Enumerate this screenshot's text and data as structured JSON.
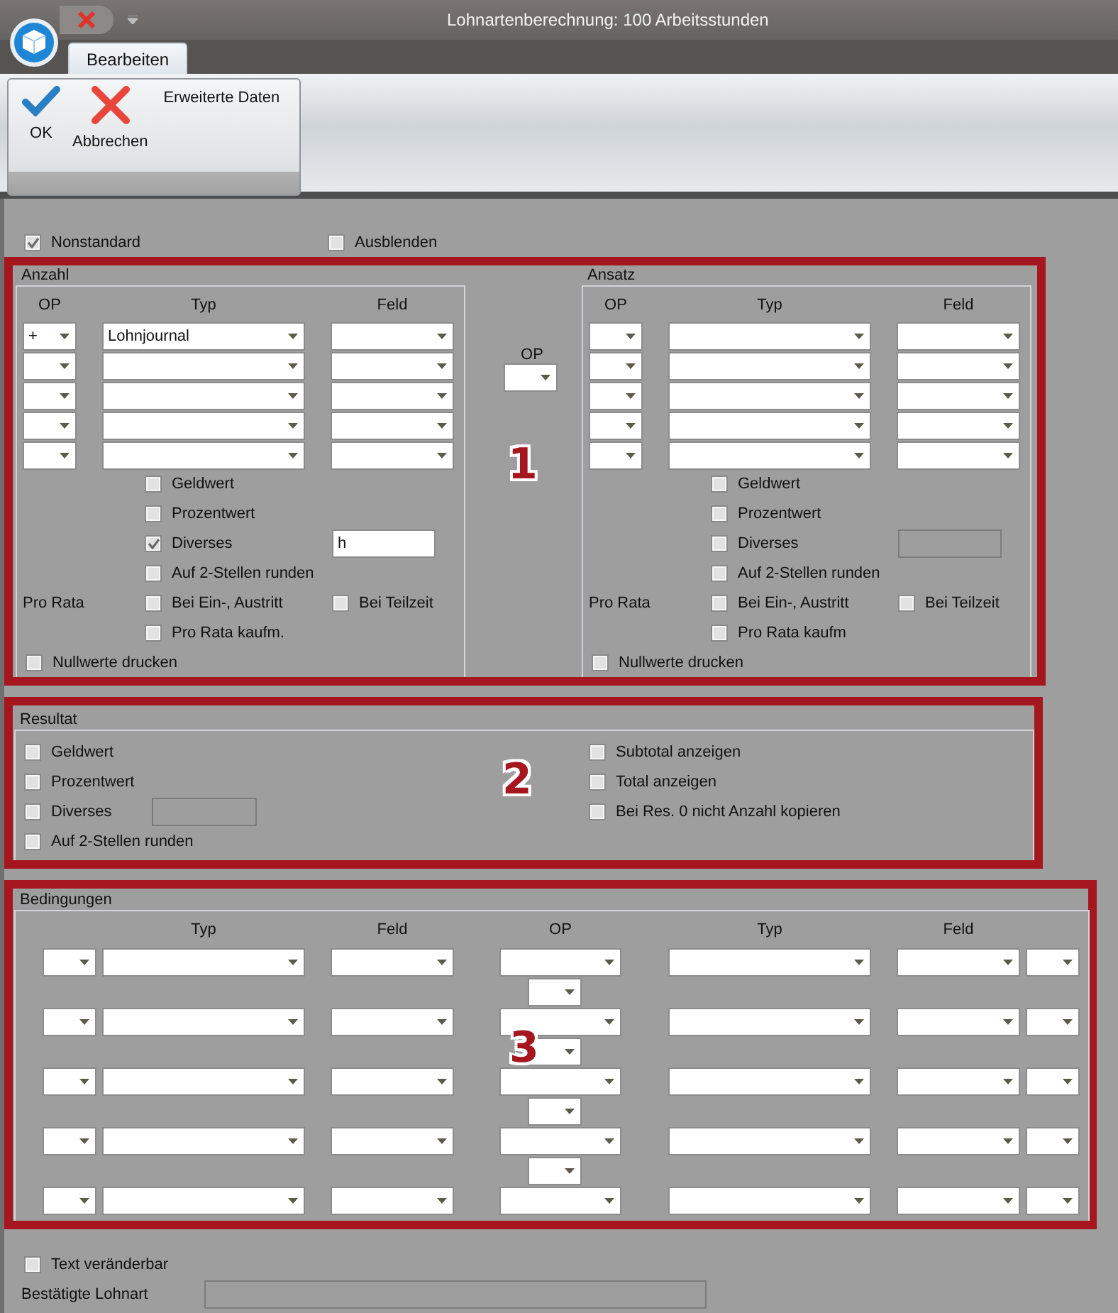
{
  "window": {
    "title": "Lohnartenberechnung: 100 Arbeitsstunden"
  },
  "tabs": [
    {
      "label": "Bearbeiten",
      "selected": true
    }
  ],
  "ribbon": {
    "buttons": [
      {
        "label": "OK",
        "kind": "ok"
      },
      {
        "label": "Abbrechen",
        "kind": "cancel"
      }
    ],
    "label": "Erweiterte Daten"
  },
  "top_options": [
    {
      "label": "Nonstandard",
      "checked": true
    },
    {
      "label": "Ausblenden",
      "checked": false
    }
  ],
  "section_1": {
    "marker": "1",
    "middle_op_label": "OP",
    "panels": [
      {
        "title": "Anzahl",
        "headers": [
          "OP",
          "Typ",
          "Feld"
        ],
        "rows": [
          {
            "op": "+",
            "typ": "Lohnjournal"
          },
          {},
          {},
          {},
          {}
        ],
        "geldwert": {
          "label": "Geldwert",
          "checked": false
        },
        "prozentwert": {
          "label": "Prozentwert",
          "checked": false
        },
        "diverses": {
          "label": "Diverses",
          "checked": true,
          "value": "h",
          "field_disabled": false
        },
        "runden": {
          "label": "Auf 2-Stellen runden",
          "checked": false
        },
        "pro_rata_label": "Pro Rata",
        "ein_austritt": {
          "label": "Bei Ein-, Austritt",
          "checked": false
        },
        "teilzeit": {
          "label": "Bei Teilzeit",
          "checked": false
        },
        "kaufm": {
          "label": "Pro Rata kaufm.",
          "checked": false
        },
        "nullwerte": {
          "label": "Nullwerte drucken",
          "checked": false
        }
      },
      {
        "title": "Ansatz",
        "headers": [
          "OP",
          "Typ",
          "Feld"
        ],
        "rows": [
          {},
          {},
          {},
          {},
          {}
        ],
        "geldwert": {
          "label": "Geldwert",
          "checked": false
        },
        "prozentwert": {
          "label": "Prozentwert",
          "checked": false
        },
        "diverses": {
          "label": "Diverses",
          "checked": false,
          "field_disabled": true
        },
        "runden": {
          "label": "Auf 2-Stellen runden",
          "checked": false
        },
        "pro_rata_label": "Pro Rata",
        "ein_austritt": {
          "label": "Bei Ein-, Austritt",
          "checked": false
        },
        "teilzeit": {
          "label": "Bei Teilzeit",
          "checked": false
        },
        "kaufm": {
          "label": "Pro Rata kaufm",
          "checked": false
        },
        "nullwerte": {
          "label": "Nullwerte drucken",
          "checked": false
        }
      }
    ]
  },
  "section_2": {
    "marker": "2",
    "title": "Resultat",
    "left": [
      {
        "label": "Geldwert",
        "checked": false,
        "kind": "plain"
      },
      {
        "label": "Prozentwert",
        "checked": false,
        "kind": "plain"
      },
      {
        "label": "Diverses",
        "checked": false,
        "kind": "field"
      },
      {
        "label": "Auf 2-Stellen runden",
        "checked": false,
        "kind": "plain"
      }
    ],
    "right": [
      {
        "label": "Subtotal anzeigen",
        "checked": false
      },
      {
        "label": "Total anzeigen",
        "checked": false
      },
      {
        "label": "Bei Res. 0 nicht Anzahl kopieren",
        "checked": false
      }
    ]
  },
  "section_3": {
    "marker": "3",
    "title": "Bedingungen",
    "headers": [
      "Typ",
      "Feld",
      "OP",
      "Typ",
      "Feld"
    ],
    "rows": [
      {},
      {},
      {},
      {},
      {}
    ]
  },
  "bottom": {
    "text_editable": {
      "label": "Text veränderbar",
      "checked": false
    },
    "confirmed_label": "Bestätigte Lohnart"
  }
}
